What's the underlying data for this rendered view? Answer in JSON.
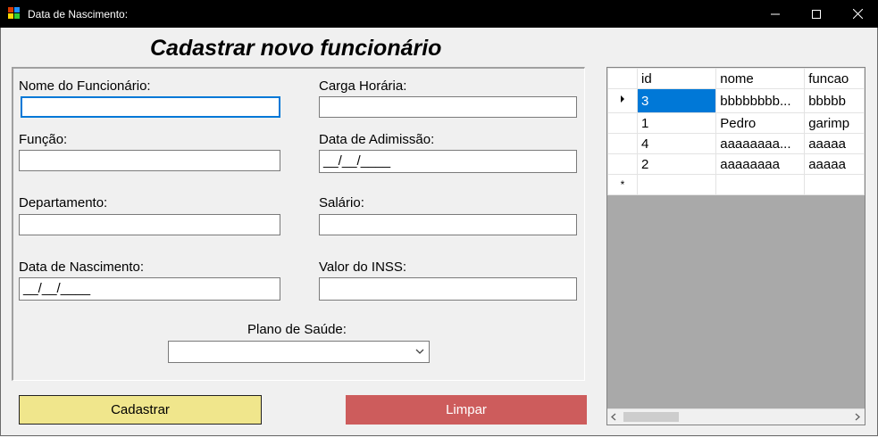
{
  "window": {
    "title": "Data de Nascimento:"
  },
  "form": {
    "heading": "Cadastrar novo funcionário",
    "nome_label": "Nome do Funcionário:",
    "nome_value": "",
    "carga_label": "Carga Horária:",
    "carga_value": "",
    "funcao_label": "Função:",
    "funcao_value": "",
    "admissao_label": "Data de Adimissão:",
    "admissao_mask": "__/__/____",
    "departamento_label": "Departamento:",
    "departamento_value": "",
    "salario_label": "Salário:",
    "salario_value": "",
    "nascimento_label": "Data de Nascimento:",
    "nascimento_mask": "__/__/____",
    "inss_label": "Valor do INSS:",
    "inss_value": "",
    "plano_label": "Plano de Saúde:",
    "plano_value": ""
  },
  "buttons": {
    "cadastrar": "Cadastrar",
    "limpar": "Limpar"
  },
  "colors": {
    "cadastrar_bg": "#f0e68c",
    "limpar_bg": "#cd5c5c",
    "selection": "#0078d7"
  },
  "grid": {
    "columns": [
      "id",
      "nome",
      "funcao"
    ],
    "rows": [
      [
        "3",
        "bbbbbbbb...",
        "bbbbb"
      ],
      [
        "1",
        "Pedro",
        "garimp"
      ],
      [
        "4",
        "aaaaaaaa...",
        "aaaaa"
      ],
      [
        "2",
        "aaaaaaaa",
        "aaaaa"
      ]
    ],
    "new_row_marker": "*"
  }
}
